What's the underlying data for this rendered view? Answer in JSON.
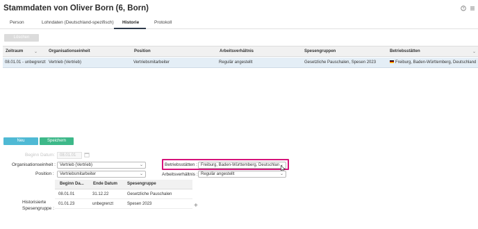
{
  "header": {
    "title": "Stammdaten von Oliver Born (6, Born)",
    "help_icon": "help-circle-icon",
    "menu_icon": "hamburger-menu-icon"
  },
  "tabs": [
    {
      "label": "Person",
      "active": false
    },
    {
      "label": "Lohndaten (Deutschland-spezifisch)",
      "active": false
    },
    {
      "label": "Historie",
      "active": true
    },
    {
      "label": "Protokoll",
      "active": false
    }
  ],
  "toolbar": {
    "delete_label": "Löschen"
  },
  "grid": {
    "columns": [
      "Zeitraum",
      "Organisationseinheit",
      "Position",
      "Arbeitsverhältnis",
      "Spesengruppen",
      "Betriebsstätten"
    ],
    "rows": [
      {
        "zeitraum": "08.01.01 - unbegrenzt",
        "organisationseinheit": "Vertrieb (Vertrieb)",
        "position": "Vertriebsmitarbeiter",
        "arbeitsverhaeltnis": "Regulär angestellt",
        "spesengruppen": "Gesetzliche Pauschalen, Spesen 2023",
        "betriebsstaetten": "Freiburg, Baden-Württemberg, Deutschland"
      }
    ]
  },
  "actions": {
    "new_label": "Neu",
    "save_label": "Speichern"
  },
  "form": {
    "beginn_label": "Beginn Datum:",
    "beginn_value": "08.01.01",
    "org_label": "Organisationseinheit :",
    "org_value": "Vertrieb (Vertrieb)",
    "position_label": "Position :",
    "position_value": "Vertriebsmitarbeiter",
    "betrieb_label": "Betriebsstätten :",
    "betrieb_value": "Freiburg, Baden-Württemberg, Deutschlan",
    "arbeit_label": "Arbeitsverhältnis :",
    "arbeit_value": "Regulär angestellt",
    "spesen_label_1": "Historisierte",
    "spesen_label_2": "Spesengruppe :"
  },
  "spesen_table": {
    "columns": [
      "Beginn Da...",
      "Ende Datum",
      "Spesengruppe"
    ],
    "rows": [
      {
        "beginn": "08.01.01",
        "ende": "31.12.22",
        "gruppe": "Gesetzliche Pauschalen"
      },
      {
        "beginn": "01.01.23",
        "ende": "unbegrenzt",
        "gruppe": "Spesen 2023"
      }
    ]
  },
  "colors": {
    "accent_new": "#4fb9d4",
    "accent_save": "#3db889",
    "highlight": "#d6137a",
    "row_selected": "#e4eef6"
  }
}
